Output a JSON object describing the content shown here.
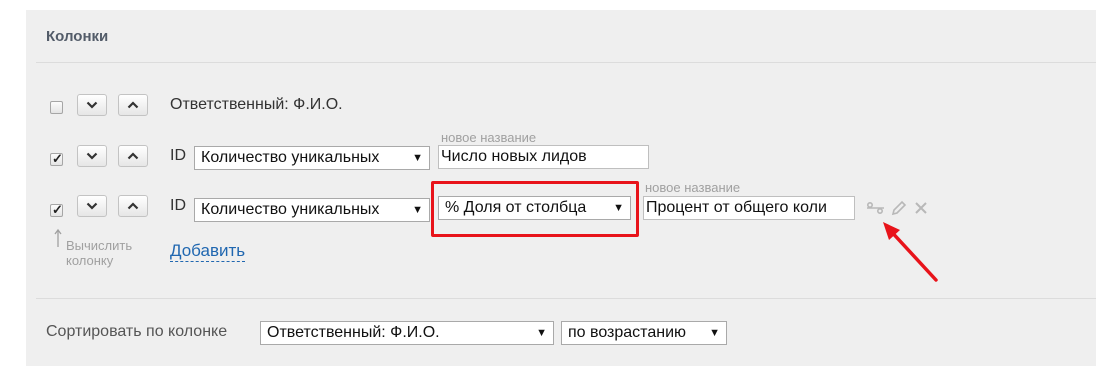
{
  "section": {
    "title": "Колонки"
  },
  "rows": [
    {
      "checked": false,
      "field_label": "Ответственный: Ф.И.О."
    },
    {
      "checked": true,
      "prefix": "ID",
      "aggregate": "Количество уникальных",
      "new_name_hint": "новое название",
      "new_name_value": "Число новых лидов"
    },
    {
      "checked": true,
      "prefix": "ID",
      "aggregate": "Количество уникальных",
      "calc": "% Доля от столбца",
      "new_name_hint": "новое название",
      "new_name_value": "Процент от общего коли"
    }
  ],
  "calc_column": {
    "label_line1": "Вычислить",
    "label_line2": "колонку"
  },
  "add_link": "Добавить",
  "sort": {
    "label": "Сортировать по колонке",
    "column_value": "Ответственный: Ф.И.О.",
    "order_value": "по возрастанию"
  },
  "icons": [
    "checkbox-icon",
    "chevron-down-icon",
    "chevron-up-icon",
    "percent-icon",
    "pencil-icon",
    "close-icon",
    "red-arrow-annotation"
  ],
  "colors": {
    "panel": "#efefef",
    "link": "#2067b0",
    "highlight": "#e8131a"
  }
}
